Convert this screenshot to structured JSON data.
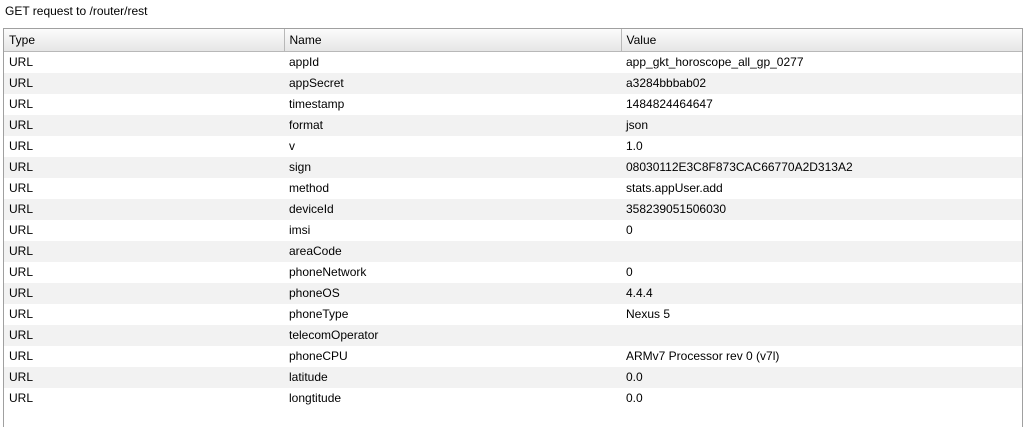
{
  "title": "GET request to /router/rest",
  "columns": [
    "Type",
    "Name",
    "Value"
  ],
  "rows": [
    {
      "type": "URL",
      "name": "appId",
      "value": "app_gkt_horoscope_all_gp_0277"
    },
    {
      "type": "URL",
      "name": "appSecret",
      "value": "a3284bbbab02"
    },
    {
      "type": "URL",
      "name": "timestamp",
      "value": "1484824464647"
    },
    {
      "type": "URL",
      "name": "format",
      "value": "json"
    },
    {
      "type": "URL",
      "name": "v",
      "value": "1.0"
    },
    {
      "type": "URL",
      "name": "sign",
      "value": "08030112E3C8F873CAC66770A2D313A2"
    },
    {
      "type": "URL",
      "name": "method",
      "value": "stats.appUser.add"
    },
    {
      "type": "URL",
      "name": "deviceId",
      "value": "358239051506030"
    },
    {
      "type": "URL",
      "name": "imsi",
      "value": "0"
    },
    {
      "type": "URL",
      "name": "areaCode",
      "value": ""
    },
    {
      "type": "URL",
      "name": "phoneNetwork",
      "value": "0"
    },
    {
      "type": "URL",
      "name": "phoneOS",
      "value": "4.4.4"
    },
    {
      "type": "URL",
      "name": "phoneType",
      "value": "Nexus 5"
    },
    {
      "type": "URL",
      "name": "telecomOperator",
      "value": ""
    },
    {
      "type": "URL",
      "name": "phoneCPU",
      "value": "ARMv7 Processor rev 0 (v7l)"
    },
    {
      "type": "URL",
      "name": "latitude",
      "value": "0.0"
    },
    {
      "type": "URL",
      "name": "longtitude",
      "value": "0.0"
    }
  ]
}
